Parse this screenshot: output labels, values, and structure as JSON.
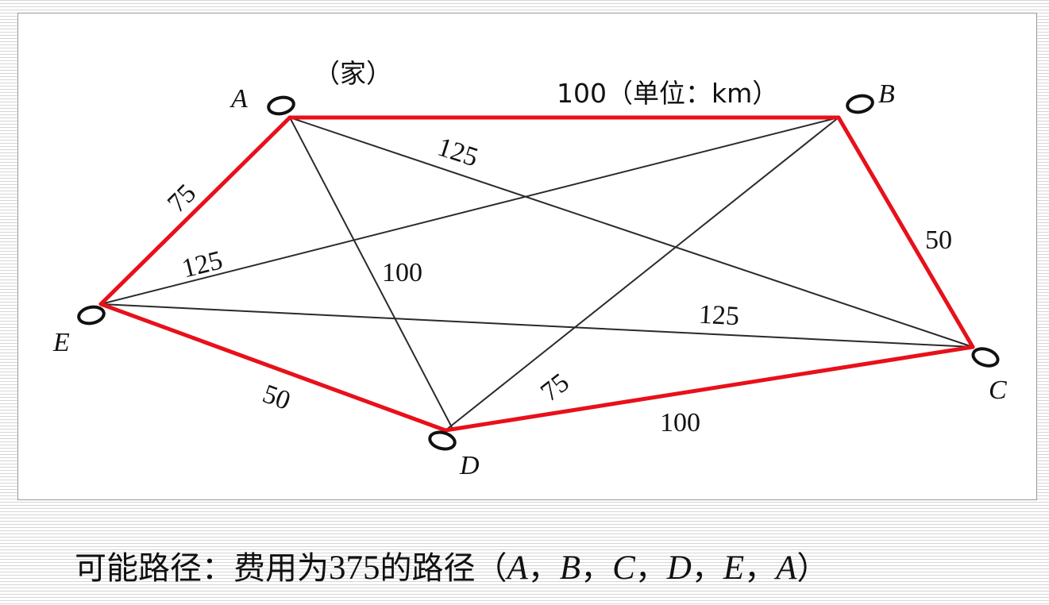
{
  "diagram": {
    "home_label": "（家）",
    "unit_label": "100（单位：km）",
    "nodes": [
      {
        "id": "A",
        "label": "A"
      },
      {
        "id": "B",
        "label": "B"
      },
      {
        "id": "C",
        "label": "C"
      },
      {
        "id": "D",
        "label": "D"
      },
      {
        "id": "E",
        "label": "E"
      }
    ],
    "edges": [
      {
        "from": "A",
        "to": "B",
        "distance": "100",
        "on_route": true,
        "label": "100"
      },
      {
        "from": "A",
        "to": "C",
        "distance": "125",
        "on_route": false,
        "label": "125"
      },
      {
        "from": "A",
        "to": "D",
        "distance": "100",
        "on_route": false,
        "label": "100"
      },
      {
        "from": "A",
        "to": "E",
        "distance": "75",
        "on_route": true,
        "label": "75"
      },
      {
        "from": "B",
        "to": "C",
        "distance": "50",
        "on_route": true,
        "label": "50"
      },
      {
        "from": "B",
        "to": "D",
        "distance": "75",
        "on_route": false,
        "label": "75"
      },
      {
        "from": "B",
        "to": "E",
        "distance": "125",
        "on_route": false,
        "label": "125"
      },
      {
        "from": "C",
        "to": "D",
        "distance": "100",
        "on_route": true,
        "label": "100"
      },
      {
        "from": "C",
        "to": "E",
        "distance": "125",
        "on_route": false,
        "label": "125"
      },
      {
        "from": "D",
        "to": "E",
        "distance": "50",
        "on_route": true,
        "label": "50"
      }
    ],
    "route_color": "#e8101a",
    "edge_color": "#2a2a2a"
  },
  "caption": {
    "prefix": "可能路径：费用为",
    "cost": "375",
    "middle": "的路径（",
    "route": [
      "A",
      "B",
      "C",
      "D",
      "E",
      "A"
    ],
    "separator": "，",
    "suffix": "）"
  }
}
